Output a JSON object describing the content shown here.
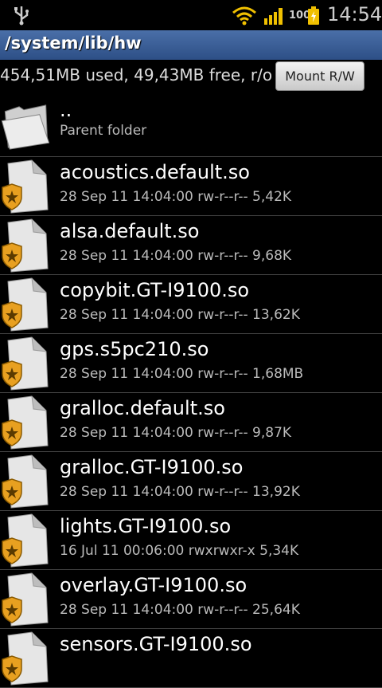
{
  "status": {
    "battery_level": "100",
    "time": "14:54"
  },
  "path": "/system/lib/hw",
  "storage": {
    "info": "454,51MB used, 49,43MB free, r/o",
    "mount_button": "Mount R/W"
  },
  "parent": {
    "name": "..",
    "label": "Parent folder"
  },
  "files": [
    {
      "name": "acoustics.default.so",
      "meta": "28 Sep 11 14:04:00  rw-r--r--  5,42K"
    },
    {
      "name": "alsa.default.so",
      "meta": "28 Sep 11 14:04:00  rw-r--r--  9,68K"
    },
    {
      "name": "copybit.GT-I9100.so",
      "meta": "28 Sep 11 14:04:00  rw-r--r--  13,62K"
    },
    {
      "name": "gps.s5pc210.so",
      "meta": "28 Sep 11 14:04:00  rw-r--r--  1,68MB"
    },
    {
      "name": "gralloc.default.so",
      "meta": "28 Sep 11 14:04:00  rw-r--r--  9,87K"
    },
    {
      "name": "gralloc.GT-I9100.so",
      "meta": "28 Sep 11 14:04:00  rw-r--r--  13,92K"
    },
    {
      "name": "lights.GT-I9100.so",
      "meta": "16 Jul 11 00:06:00  rwxrwxr-x  5,34K"
    },
    {
      "name": "overlay.GT-I9100.so",
      "meta": "28 Sep 11 14:04:00  rw-r--r--  25,64K"
    },
    {
      "name": "sensors.GT-I9100.so",
      "meta": ""
    }
  ],
  "colors": {
    "path_bar": "#3b5e98",
    "background": "#000000"
  }
}
